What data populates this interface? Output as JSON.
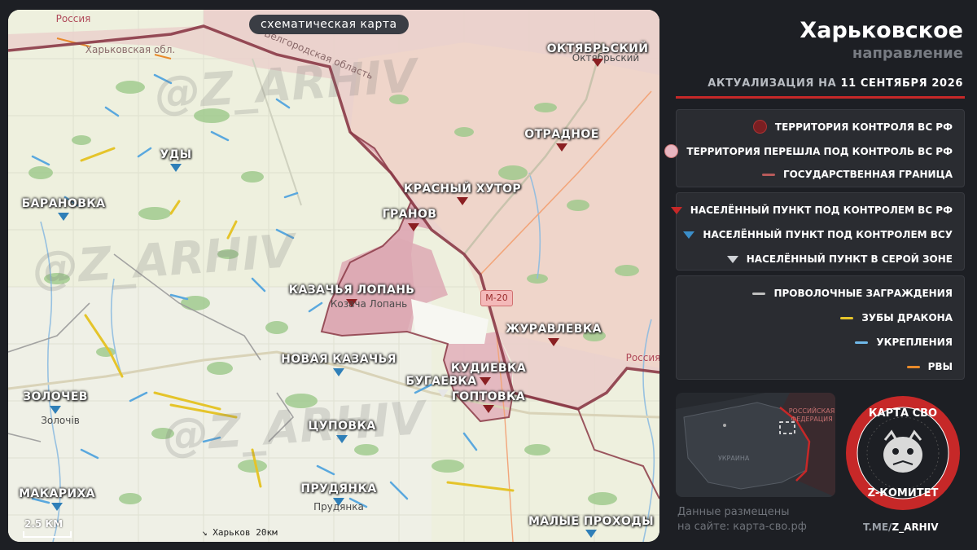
{
  "map": {
    "title": "схематическая карта",
    "scale_label": "2.5 КМ",
    "direction_note": "Харьков 20км",
    "road_label": "М-20",
    "watermark": "@Z_ARHIV",
    "region_labels": {
      "russia": "Россия",
      "belgorod_oblast": "Белгородская область",
      "russia_east": "Россия",
      "kharkiv_oblast": "Харьковская обл."
    },
    "towns": [
      {
        "name": "ОКТЯБРЬСКИЙ",
        "control": "ru",
        "under": "Октябрьский"
      },
      {
        "name": "ОТРАДНОЕ",
        "control": "ru",
        "under": ""
      },
      {
        "name": "УДЫ",
        "control": "ua",
        "under": ""
      },
      {
        "name": "БАРАНОВКА",
        "control": "ua",
        "under": ""
      },
      {
        "name": "КРАСНЫЙ ХУТОР",
        "control": "ru",
        "under": ""
      },
      {
        "name": "ГРАНОВ",
        "control": "ru",
        "under": ""
      },
      {
        "name": "КАЗАЧЬЯ ЛОПАНЬ",
        "control": "ru",
        "under": "Козача Лопань"
      },
      {
        "name": "ЖУРАВЛЕВКА",
        "control": "ru",
        "under": ""
      },
      {
        "name": "НОВАЯ КАЗАЧЬЯ",
        "control": "ua",
        "under": ""
      },
      {
        "name": "КУДИЕВКА",
        "control": "ru",
        "under": ""
      },
      {
        "name": "БУГАЕВКА",
        "control": "gray",
        "under": ""
      },
      {
        "name": "ГОПТОВКА",
        "control": "ru",
        "under": ""
      },
      {
        "name": "ЗОЛОЧЕВ",
        "control": "ua",
        "under": "Золочів"
      },
      {
        "name": "ЦУПОВКА",
        "control": "ua",
        "under": ""
      },
      {
        "name": "МАКАРИХА",
        "control": "ua",
        "under": ""
      },
      {
        "name": "ПРУДЯНКА",
        "control": "ua",
        "under": "Прудянка"
      },
      {
        "name": "МАЛЫЕ ПРОХОДЫ",
        "control": "ua",
        "under": ""
      }
    ]
  },
  "panel": {
    "title": "Харьковское",
    "subtitle": "направление",
    "date_prefix": "АКТУАЛИЗАЦИЯ НА",
    "date_value": "11 СЕНТЯБРЯ 2026",
    "legend_territory": [
      {
        "label": "ТЕРРИТОРИЯ КОНТРОЛЯ ВС РФ",
        "color": "#7a1f22",
        "shape": "circle"
      },
      {
        "label": "ТЕРРИТОРИЯ ПЕРЕШЛА ПОД КОНТРОЛЬ ВС РФ",
        "color": "#e8b6c0",
        "shape": "circle"
      },
      {
        "label": "ГОСУДАРСТВЕННАЯ ГРАНИЦА",
        "color": "#b85a5a",
        "shape": "line"
      }
    ],
    "legend_settlements": [
      {
        "label": "НАСЕЛЁННЫЙ ПУНКТ ПОД КОНТРОЛЕМ ВС РФ",
        "color": "#c62828"
      },
      {
        "label": "НАСЕЛЁННЫЙ ПУНКТ ПОД КОНТРОЛЕМ ВСУ",
        "color": "#3b8ec9"
      },
      {
        "label": "НАСЕЛЁННЫЙ ПУНКТ В СЕРОЙ ЗОНЕ",
        "color": "#cfd2d6"
      }
    ],
    "legend_fortifications": [
      {
        "label": "ПРОВОЛОЧНЫЕ ЗАГРАЖДЕНИЯ",
        "color": "#bfbfbf"
      },
      {
        "label": "ЗУБЫ ДРАКОНА",
        "color": "#e5c42a"
      },
      {
        "label": "УКРЕПЛЕНИЯ",
        "color": "#6fb8e8"
      },
      {
        "label": "РВЫ",
        "color": "#e88a2a"
      }
    ],
    "inset": {
      "russia_label": "РОССИЙСКАЯ ФЕДЕРАЦИЯ",
      "ukraine_label": "УКРАИНА"
    },
    "footer_line1": "Данные размещены",
    "footer_line2": "на сайте: карта-сво.рф",
    "logo_top": "КАРТА СВО",
    "logo_bottom": "Z-КОМИТЕТ",
    "telegram_prefix": "T.ME/",
    "telegram_handle": "Z_ARHIV"
  },
  "colors": {
    "ru_territory": "#e9cfca",
    "recent_territory": "#dda9b4",
    "border": "#8b3a47",
    "ua_marker": "#2f7fb8",
    "ru_marker": "#8a1f22",
    "accent": "#c62828"
  }
}
